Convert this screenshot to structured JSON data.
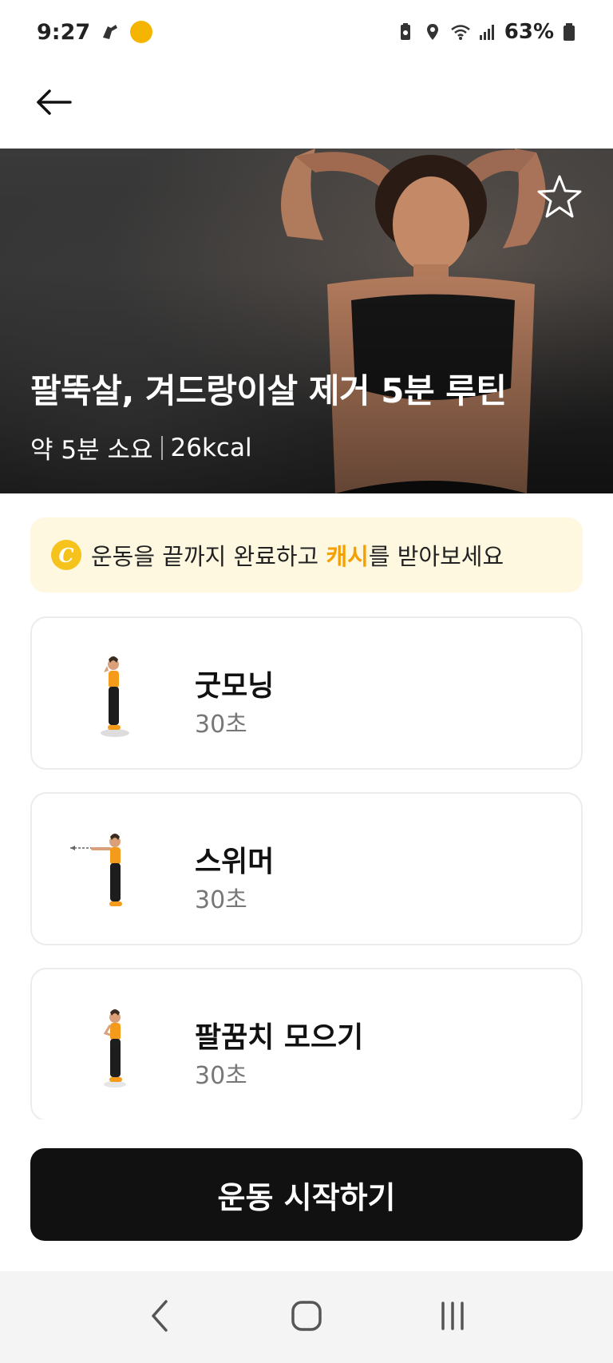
{
  "status_bar": {
    "time": "9:27",
    "battery": "63%",
    "icons": [
      "sports-app-icon",
      "coin-app-icon",
      "battery-saver-icon",
      "location-icon",
      "wifi-icon",
      "signal-icon",
      "battery-icon"
    ]
  },
  "app_bar": {
    "back_icon": "arrow-left-icon"
  },
  "hero": {
    "title": "팔뚝살, 겨드랑이살 제거 5분 루틴",
    "duration": "약 5분 소요",
    "calories": "26kcal",
    "favorite_icon": "star-outline-icon"
  },
  "cash_banner": {
    "coin_label": "C",
    "text_before": "운동을 끝까지 완료하고 ",
    "highlight": "캐시",
    "text_after": "를 받아보세요",
    "accent_color": "#f4a000"
  },
  "exercises": [
    {
      "name": "굿모닝",
      "duration": "30초"
    },
    {
      "name": "스위머",
      "duration": "30초"
    },
    {
      "name": "팔꿈치 모으기",
      "duration": "30초"
    }
  ],
  "start_button": {
    "label": "운동 시작하기"
  },
  "nav_bar": {
    "icons": [
      "nav-back-icon",
      "nav-home-icon",
      "nav-recents-icon"
    ]
  },
  "colors": {
    "primary_button": "#111111",
    "banner_bg": "#fff8e1",
    "accent": "#f4a000"
  }
}
